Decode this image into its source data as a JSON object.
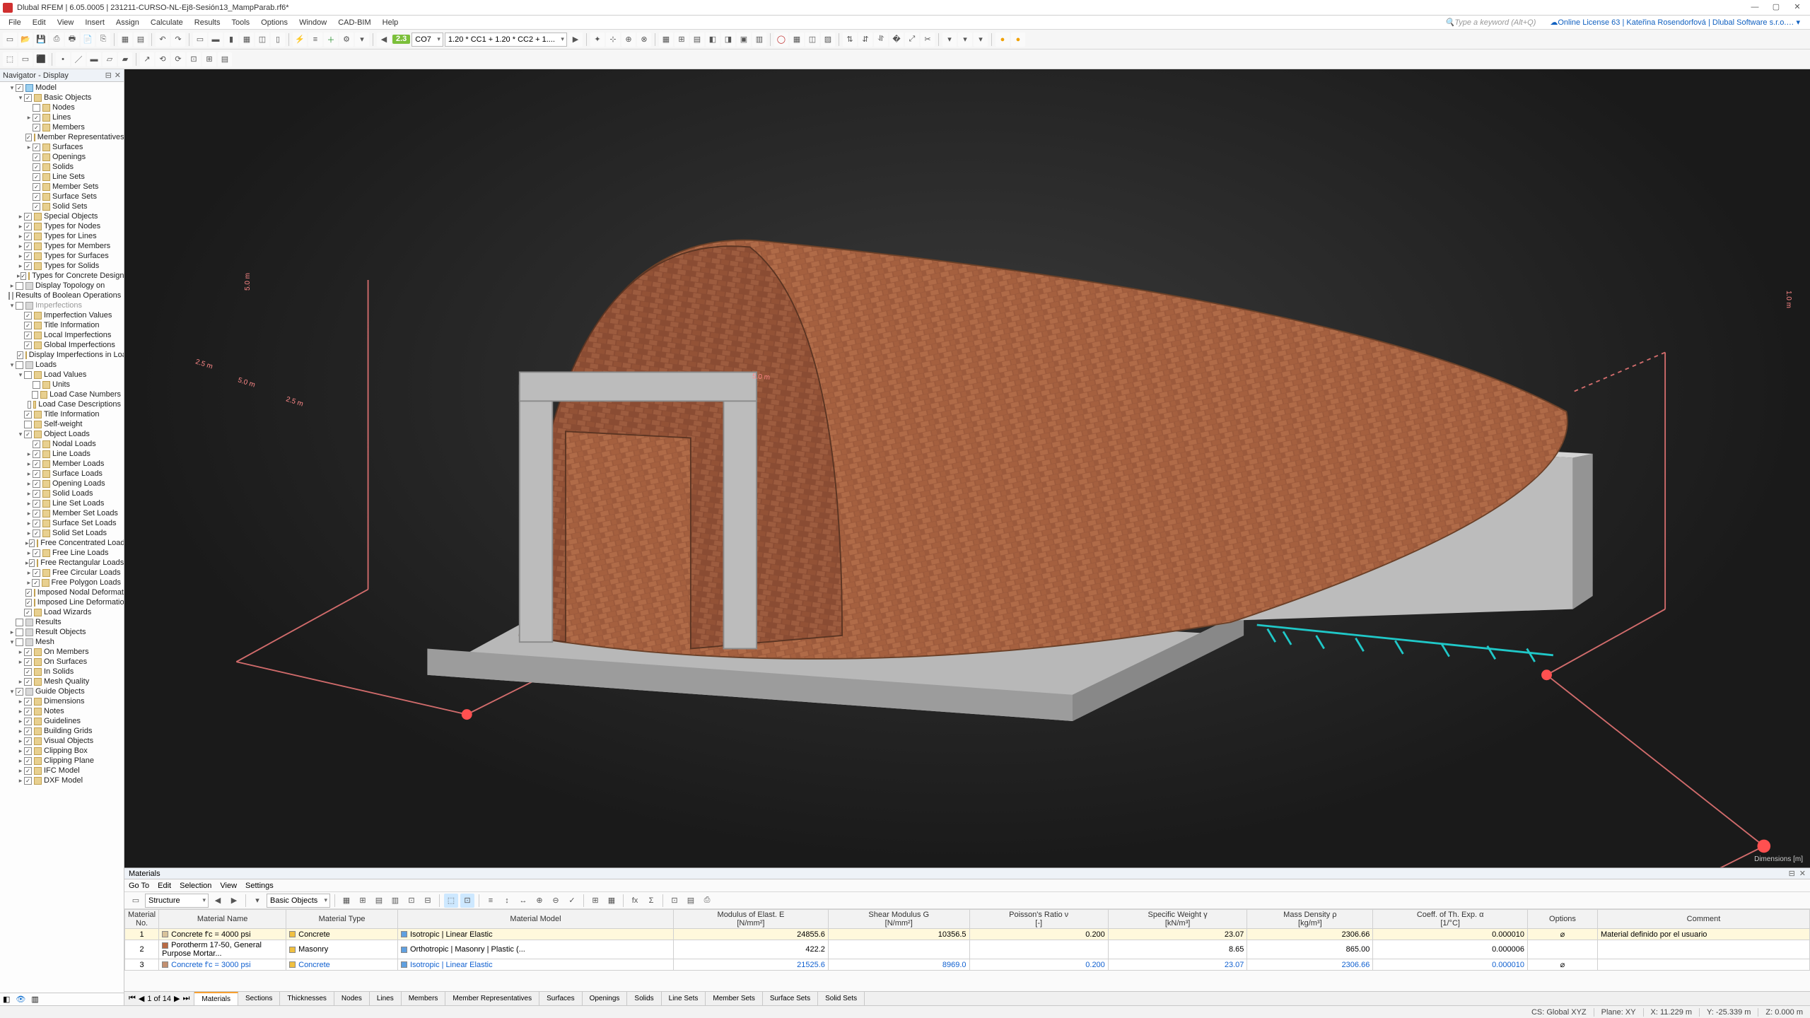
{
  "title": "Dlubal RFEM | 6.05.0005 | 231211-CURSO-NL-Ej8-Sesión13_MampParab.rf6*",
  "menus": [
    "File",
    "Edit",
    "View",
    "Insert",
    "Assign",
    "Calculate",
    "Results",
    "Tools",
    "Options",
    "Window",
    "CAD-BIM",
    "Help"
  ],
  "search_hint": "Type a keyword (Alt+Q)",
  "license": "Online License 63 | Kateřina Rosendorfová | Dlubal Software s.r.o.",
  "toolbar": {
    "pill1": "2.3",
    "combo_lc_id": "CO7",
    "combo_lc": "1.20 * CC1 + 1.20 * CC2 + 1...."
  },
  "navigator": {
    "title": "Navigator - Display",
    "tree": [
      {
        "lvl": 1,
        "tw": "▾",
        "cb": true,
        "ic": "blue",
        "label": "Model"
      },
      {
        "lvl": 2,
        "tw": "▾",
        "cb": true,
        "ic": "",
        "label": "Basic Objects"
      },
      {
        "lvl": 3,
        "tw": "",
        "cb": false,
        "ic": "",
        "label": "Nodes"
      },
      {
        "lvl": 3,
        "tw": "▸",
        "cb": true,
        "ic": "",
        "label": "Lines"
      },
      {
        "lvl": 3,
        "tw": "",
        "cb": true,
        "ic": "",
        "label": "Members"
      },
      {
        "lvl": 3,
        "tw": "",
        "cb": true,
        "ic": "",
        "label": "Member Representatives"
      },
      {
        "lvl": 3,
        "tw": "▸",
        "cb": true,
        "ic": "",
        "label": "Surfaces"
      },
      {
        "lvl": 3,
        "tw": "",
        "cb": true,
        "ic": "",
        "label": "Openings"
      },
      {
        "lvl": 3,
        "tw": "",
        "cb": true,
        "ic": "",
        "label": "Solids"
      },
      {
        "lvl": 3,
        "tw": "",
        "cb": true,
        "ic": "",
        "label": "Line Sets"
      },
      {
        "lvl": 3,
        "tw": "",
        "cb": true,
        "ic": "",
        "label": "Member Sets"
      },
      {
        "lvl": 3,
        "tw": "",
        "cb": true,
        "ic": "",
        "label": "Surface Sets"
      },
      {
        "lvl": 3,
        "tw": "",
        "cb": true,
        "ic": "",
        "label": "Solid Sets"
      },
      {
        "lvl": 2,
        "tw": "▸",
        "cb": true,
        "ic": "",
        "label": "Special Objects"
      },
      {
        "lvl": 2,
        "tw": "▸",
        "cb": true,
        "ic": "",
        "label": "Types for Nodes"
      },
      {
        "lvl": 2,
        "tw": "▸",
        "cb": true,
        "ic": "",
        "label": "Types for Lines"
      },
      {
        "lvl": 2,
        "tw": "▸",
        "cb": true,
        "ic": "",
        "label": "Types for Members"
      },
      {
        "lvl": 2,
        "tw": "▸",
        "cb": true,
        "ic": "",
        "label": "Types for Surfaces"
      },
      {
        "lvl": 2,
        "tw": "▸",
        "cb": true,
        "ic": "",
        "label": "Types for Solids"
      },
      {
        "lvl": 2,
        "tw": "▸",
        "cb": true,
        "ic": "",
        "label": "Types for Concrete Design"
      },
      {
        "lvl": 1,
        "tw": "▸",
        "cb": false,
        "ic": "grey",
        "label": "Display Topology on"
      },
      {
        "lvl": 1,
        "tw": "",
        "cb": false,
        "ic": "grey",
        "label": "Results of Boolean Operations"
      },
      {
        "lvl": 1,
        "tw": "▾",
        "cb": false,
        "ic": "grey",
        "label": "Imperfections",
        "dim": true
      },
      {
        "lvl": 2,
        "tw": "",
        "cb": true,
        "ic": "",
        "label": "Imperfection Values"
      },
      {
        "lvl": 2,
        "tw": "",
        "cb": true,
        "ic": "",
        "label": "Title Information"
      },
      {
        "lvl": 2,
        "tw": "",
        "cb": true,
        "ic": "",
        "label": "Local Imperfections"
      },
      {
        "lvl": 2,
        "tw": "",
        "cb": true,
        "ic": "",
        "label": "Global Imperfections"
      },
      {
        "lvl": 2,
        "tw": "",
        "cb": true,
        "ic": "",
        "label": "Display Imperfections in Load Cases & ..."
      },
      {
        "lvl": 1,
        "tw": "▾",
        "cb": false,
        "ic": "grey",
        "label": "Loads"
      },
      {
        "lvl": 2,
        "tw": "▾",
        "cb": false,
        "ic": "",
        "label": "Load Values"
      },
      {
        "lvl": 3,
        "tw": "",
        "cb": false,
        "ic": "",
        "label": "Units"
      },
      {
        "lvl": 3,
        "tw": "",
        "cb": false,
        "ic": "",
        "label": "Load Case Numbers"
      },
      {
        "lvl": 3,
        "tw": "",
        "cb": false,
        "ic": "",
        "label": "Load Case Descriptions"
      },
      {
        "lvl": 2,
        "tw": "",
        "cb": true,
        "ic": "",
        "label": "Title Information"
      },
      {
        "lvl": 2,
        "tw": "",
        "cb": false,
        "ic": "",
        "label": "Self-weight"
      },
      {
        "lvl": 2,
        "tw": "▾",
        "cb": true,
        "ic": "",
        "label": "Object Loads"
      },
      {
        "lvl": 3,
        "tw": "",
        "cb": true,
        "ic": "",
        "label": "Nodal Loads"
      },
      {
        "lvl": 3,
        "tw": "▸",
        "cb": true,
        "ic": "",
        "label": "Line Loads"
      },
      {
        "lvl": 3,
        "tw": "▸",
        "cb": true,
        "ic": "",
        "label": "Member Loads"
      },
      {
        "lvl": 3,
        "tw": "▸",
        "cb": true,
        "ic": "",
        "label": "Surface Loads"
      },
      {
        "lvl": 3,
        "tw": "▸",
        "cb": true,
        "ic": "",
        "label": "Opening Loads"
      },
      {
        "lvl": 3,
        "tw": "▸",
        "cb": true,
        "ic": "",
        "label": "Solid Loads"
      },
      {
        "lvl": 3,
        "tw": "▸",
        "cb": true,
        "ic": "",
        "label": "Line Set Loads"
      },
      {
        "lvl": 3,
        "tw": "▸",
        "cb": true,
        "ic": "",
        "label": "Member Set Loads"
      },
      {
        "lvl": 3,
        "tw": "▸",
        "cb": true,
        "ic": "",
        "label": "Surface Set Loads"
      },
      {
        "lvl": 3,
        "tw": "▸",
        "cb": true,
        "ic": "",
        "label": "Solid Set Loads"
      },
      {
        "lvl": 3,
        "tw": "▸",
        "cb": true,
        "ic": "",
        "label": "Free Concentrated Loads"
      },
      {
        "lvl": 3,
        "tw": "▸",
        "cb": true,
        "ic": "",
        "label": "Free Line Loads"
      },
      {
        "lvl": 3,
        "tw": "▸",
        "cb": true,
        "ic": "",
        "label": "Free Rectangular Loads"
      },
      {
        "lvl": 3,
        "tw": "▸",
        "cb": true,
        "ic": "",
        "label": "Free Circular Loads"
      },
      {
        "lvl": 3,
        "tw": "▸",
        "cb": true,
        "ic": "",
        "label": "Free Polygon Loads"
      },
      {
        "lvl": 3,
        "tw": "",
        "cb": true,
        "ic": "",
        "label": "Imposed Nodal Deformations"
      },
      {
        "lvl": 3,
        "tw": "",
        "cb": true,
        "ic": "",
        "label": "Imposed Line Deformations"
      },
      {
        "lvl": 2,
        "tw": "",
        "cb": true,
        "ic": "",
        "label": "Load Wizards"
      },
      {
        "lvl": 1,
        "tw": "",
        "cb": false,
        "ic": "grey",
        "label": "Results"
      },
      {
        "lvl": 1,
        "tw": "▸",
        "cb": false,
        "ic": "grey",
        "label": "Result Objects"
      },
      {
        "lvl": 1,
        "tw": "▾",
        "cb": false,
        "ic": "grey",
        "label": "Mesh"
      },
      {
        "lvl": 2,
        "tw": "▸",
        "cb": true,
        "ic": "",
        "label": "On Members"
      },
      {
        "lvl": 2,
        "tw": "▸",
        "cb": true,
        "ic": "",
        "label": "On Surfaces"
      },
      {
        "lvl": 2,
        "tw": "",
        "cb": true,
        "ic": "",
        "label": "In Solids"
      },
      {
        "lvl": 2,
        "tw": "▸",
        "cb": true,
        "ic": "",
        "label": "Mesh Quality"
      },
      {
        "lvl": 1,
        "tw": "▾",
        "cb": true,
        "ic": "grey",
        "label": "Guide Objects"
      },
      {
        "lvl": 2,
        "tw": "▸",
        "cb": true,
        "ic": "",
        "label": "Dimensions"
      },
      {
        "lvl": 2,
        "tw": "▸",
        "cb": true,
        "ic": "",
        "label": "Notes"
      },
      {
        "lvl": 2,
        "tw": "▸",
        "cb": true,
        "ic": "",
        "label": "Guidelines"
      },
      {
        "lvl": 2,
        "tw": "▸",
        "cb": true,
        "ic": "",
        "label": "Building Grids"
      },
      {
        "lvl": 2,
        "tw": "▸",
        "cb": true,
        "ic": "",
        "label": "Visual Objects"
      },
      {
        "lvl": 2,
        "tw": "▸",
        "cb": true,
        "ic": "",
        "label": "Clipping Box"
      },
      {
        "lvl": 2,
        "tw": "▸",
        "cb": true,
        "ic": "",
        "label": "Clipping Plane"
      },
      {
        "lvl": 2,
        "tw": "▸",
        "cb": true,
        "ic": "",
        "label": "IFC Model"
      },
      {
        "lvl": 2,
        "tw": "▸",
        "cb": true,
        "ic": "",
        "label": "DXF Model"
      }
    ]
  },
  "viewport": {
    "dims": [
      "5.0 m",
      "2.5 m",
      "5.0 m",
      "2.5 m",
      "5.0 m",
      "5.0 m",
      "1.0 m"
    ],
    "corner": "Dimensions [m]"
  },
  "materials": {
    "title": "Materials",
    "menu": [
      "Go To",
      "Edit",
      "Selection",
      "View",
      "Settings"
    ],
    "structure_combo": "Structure",
    "basic_combo": "Basic Objects",
    "pager": "1 of 14",
    "tabs": [
      "Materials",
      "Sections",
      "Thicknesses",
      "Nodes",
      "Lines",
      "Members",
      "Member Representatives",
      "Surfaces",
      "Openings",
      "Solids",
      "Line Sets",
      "Member Sets",
      "Surface Sets",
      "Solid Sets"
    ],
    "headers_top": [
      "Material No.",
      "Material Name",
      "Material Type",
      "Material Model",
      "Modulus of Elast. E [N/mm²]",
      "Shear Modulus G [N/mm²]",
      "Poisson's Ratio ν [-]",
      "Specific Weight γ [kN/m³]",
      "Mass Density ρ [kg/m³]",
      "Coeff. of Th. Exp. α [1/°C]",
      "Options",
      "Comment"
    ],
    "rows": [
      {
        "no": "1",
        "sw": "#d8c29a",
        "name": "Concrete f'c = 4000 psi",
        "type": "Concrete",
        "model": "Isotropic | Linear Elastic",
        "e": "24855.6",
        "g": "10356.5",
        "nu": "0.200",
        "sw_": "23.07",
        "rho": "2306.66",
        "alpha": "0.000010",
        "opt": "⌀",
        "comment": "Material definido por el usuario"
      },
      {
        "no": "2",
        "sw": "#b96a44",
        "name": "Porotherm 17-50, General Purpose Mortar...",
        "type": "Masonry",
        "model": "Orthotropic | Masonry | Plastic (...",
        "e": "422.2",
        "g": "",
        "nu": "",
        "sw_": "8.65",
        "rho": "865.00",
        "alpha": "0.000006",
        "opt": "",
        "comment": ""
      },
      {
        "no": "3",
        "sw": "#c39070",
        "name": "Concrete f'c = 3000 psi",
        "type": "Concrete",
        "model": "Isotropic | Linear Elastic",
        "e": "21525.6",
        "g": "8969.0",
        "nu": "0.200",
        "sw_": "23.07",
        "rho": "2306.66",
        "alpha": "0.000010",
        "opt": "⌀",
        "comment": "",
        "blue": true
      }
    ]
  },
  "status": {
    "cs": "CS: Global XYZ",
    "plane": "Plane: XY",
    "x": "X: 11.229 m",
    "y": "Y: -25.339 m",
    "z": "Z: 0.000 m"
  }
}
